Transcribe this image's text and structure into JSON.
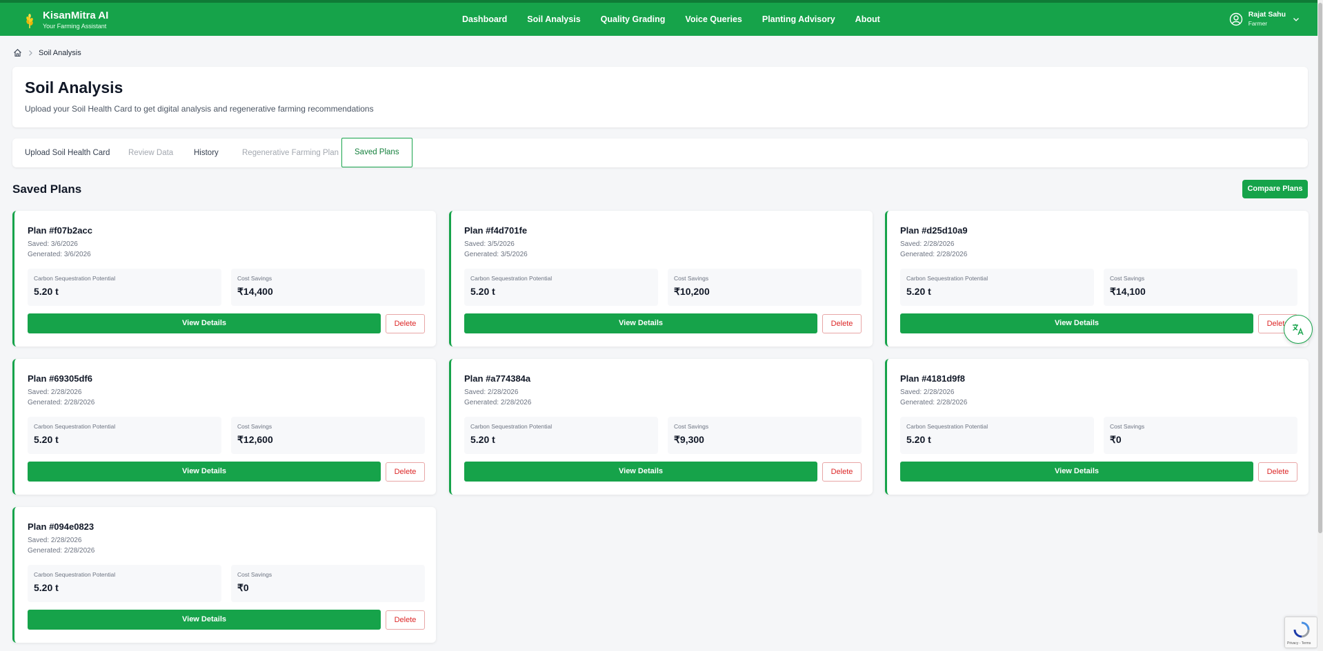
{
  "header": {
    "brand_name": "KisanMitra AI",
    "brand_tagline": "Your Farming Assistant",
    "nav": [
      "Dashboard",
      "Soil Analysis",
      "Quality Grading",
      "Voice Queries",
      "Planting Advisory",
      "About"
    ],
    "user_name": "Rajat Sahu",
    "user_role": "Farmer",
    "accent_color": "#16a34a"
  },
  "breadcrumb": {
    "current": "Soil Analysis"
  },
  "page": {
    "title": "Soil Analysis",
    "subtitle": "Upload your Soil Health Card to get digital analysis and regenerative farming recommendations"
  },
  "tabs": [
    {
      "label": "Upload Soil Health Card",
      "state": "enabled"
    },
    {
      "label": "Review Data",
      "state": "disabled"
    },
    {
      "label": "History",
      "state": "enabled"
    },
    {
      "label": "Regenerative Farming Plan",
      "state": "disabled"
    },
    {
      "label": "Saved Plans",
      "state": "active"
    }
  ],
  "section": {
    "title": "Saved Plans",
    "compare_label": "Compare Plans"
  },
  "labels": {
    "carbon": "Carbon Sequestration Potential",
    "cost": "Cost Savings",
    "view": "View Details",
    "delete": "Delete"
  },
  "plans": [
    {
      "title": "Plan #f07b2acc",
      "saved": "Saved: 3/6/2026",
      "generated": "Generated: 3/6/2026",
      "carbon": "5.20 t",
      "cost": "₹14,400"
    },
    {
      "title": "Plan #f4d701fe",
      "saved": "Saved: 3/5/2026",
      "generated": "Generated: 3/5/2026",
      "carbon": "5.20 t",
      "cost": "₹10,200"
    },
    {
      "title": "Plan #d25d10a9",
      "saved": "Saved: 2/28/2026",
      "generated": "Generated: 2/28/2026",
      "carbon": "5.20 t",
      "cost": "₹14,100"
    },
    {
      "title": "Plan #69305df6",
      "saved": "Saved: 2/28/2026",
      "generated": "Generated: 2/28/2026",
      "carbon": "5.20 t",
      "cost": "₹12,600"
    },
    {
      "title": "Plan #a774384a",
      "saved": "Saved: 2/28/2026",
      "generated": "Generated: 2/28/2026",
      "carbon": "5.20 t",
      "cost": "₹9,300"
    },
    {
      "title": "Plan #4181d9f8",
      "saved": "Saved: 2/28/2026",
      "generated": "Generated: 2/28/2026",
      "carbon": "5.20 t",
      "cost": "₹0"
    },
    {
      "title": "Plan #094e0823",
      "saved": "Saved: 2/28/2026",
      "generated": "Generated: 2/28/2026",
      "carbon": "5.20 t",
      "cost": "₹0"
    }
  ],
  "recaptcha": {
    "text": "Privacy - Terms"
  }
}
